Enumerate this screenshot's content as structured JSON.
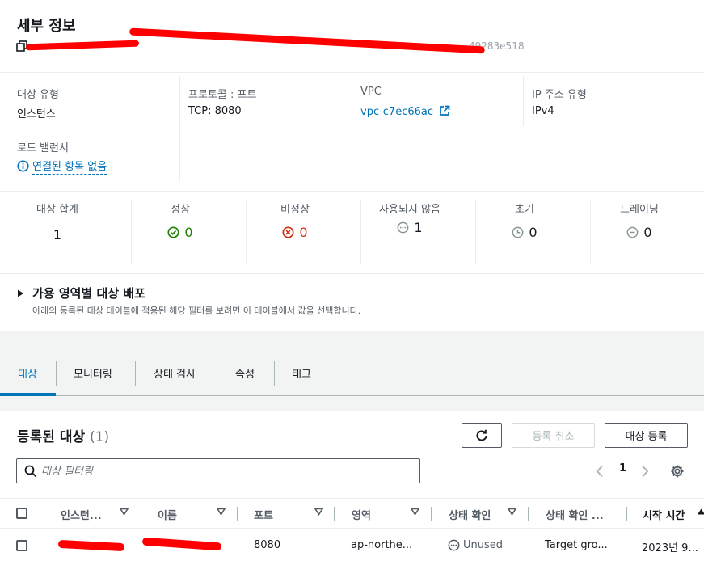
{
  "details": {
    "title": "세부 정보",
    "arn_suffix": "49283e518",
    "target_type": {
      "label": "대상 유형",
      "value": "인스턴스"
    },
    "protocol_port": {
      "label": "프로토콜 : 포트",
      "value": "TCP: 8080"
    },
    "vpc": {
      "label": "VPC",
      "value": "vpc-c7ec66ac"
    },
    "ip_type": {
      "label": "IP 주소 유형",
      "value": "IPv4"
    },
    "load_balancer": {
      "label": "로드 밸런서",
      "value": "연결된 항목 없음"
    }
  },
  "stats": [
    {
      "label": "대상 합계",
      "value": "1"
    },
    {
      "label": "정상",
      "value": "0"
    },
    {
      "label": "비정상",
      "value": "0"
    },
    {
      "label": "사용되지 않음",
      "value": "1"
    },
    {
      "label": "초기",
      "value": "0"
    },
    {
      "label": "드레이닝",
      "value": "0"
    }
  ],
  "az": {
    "title": "가용 영역별 대상 배포",
    "description": "아래의 등록된 대상 테이블에 적용된 해당 필터를 보려면 이 테이블에서 값을 선택합니다."
  },
  "tabs": [
    "대상",
    "모니터링",
    "상태 검사",
    "속성",
    "태그"
  ],
  "registered": {
    "title": "등록된 대상",
    "count": "(1)",
    "deregister_label": "등록 취소",
    "register_label": "대상 등록",
    "search_placeholder": "대상 필터링",
    "page": "1",
    "columns": [
      "인스턴...",
      "이름",
      "포트",
      "영역",
      "상태 확인",
      "상태 확인 ...",
      "시작 시간"
    ],
    "row": {
      "port": "8080",
      "zone": "ap-northe...",
      "health": "Unused",
      "health_details": "Target gro...",
      "launch_time": "2023년 9..."
    }
  },
  "colors": {
    "link": "#0073bb",
    "healthy": "#1d8102",
    "unhealthy": "#d13212",
    "redaction": "#ff0000"
  }
}
